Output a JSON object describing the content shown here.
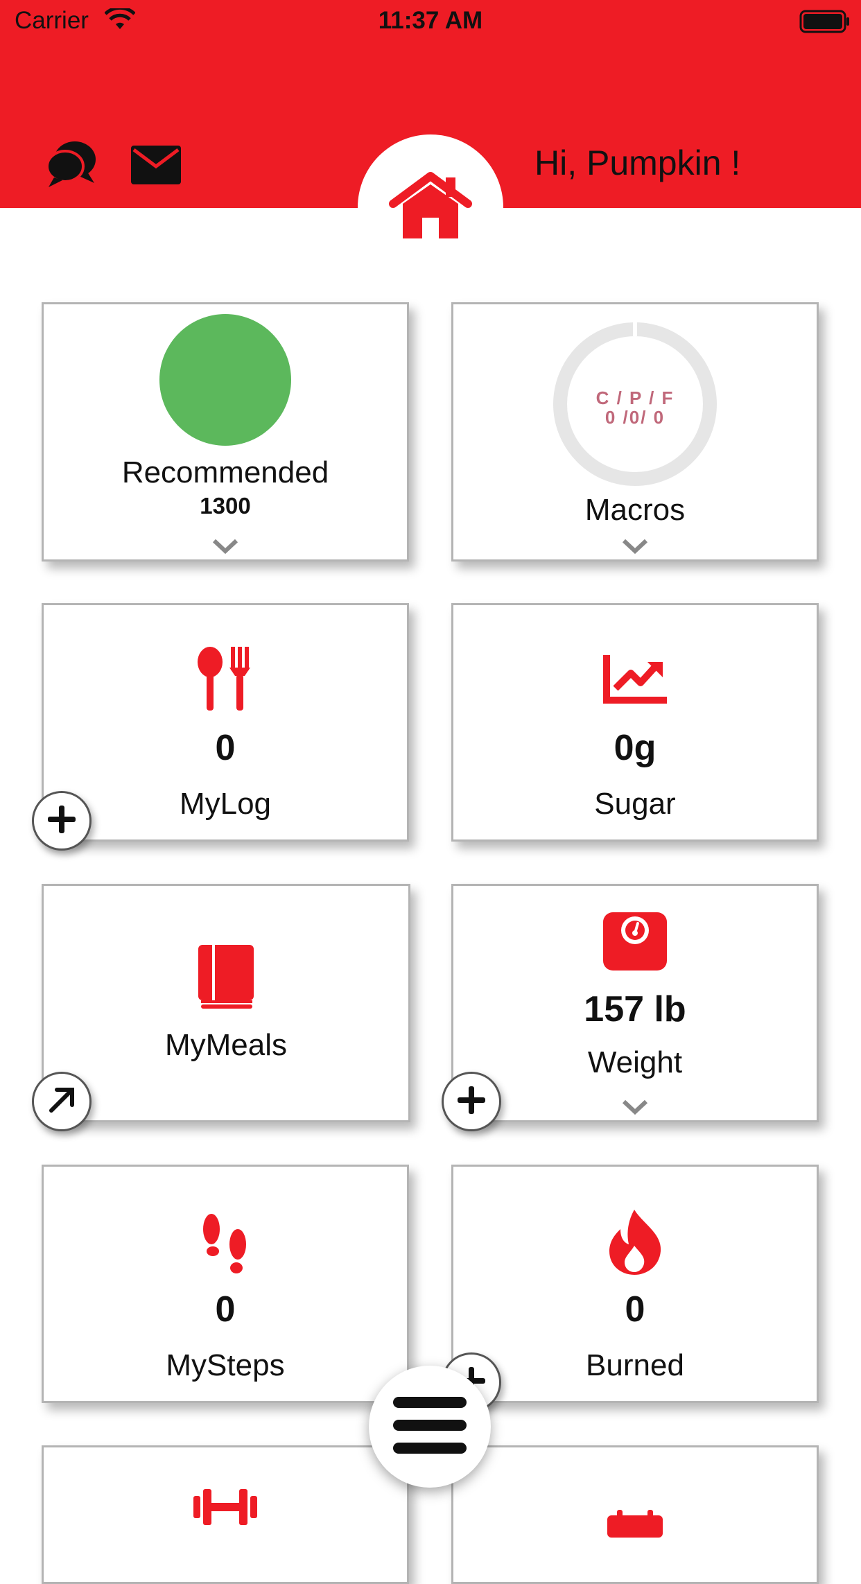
{
  "status_bar": {
    "carrier": "Carrier",
    "time": "11:37 AM"
  },
  "header": {
    "greeting": "Hi, Pumpkin !",
    "accent_color": "#ee1c25"
  },
  "cards": {
    "recommended": {
      "label": "Recommended",
      "value": "1300",
      "ring_color": "#5cb85c"
    },
    "macros": {
      "label": "Macros",
      "heading": "C / P / F",
      "values": "0 /0/ 0",
      "c_color": "#c0687a",
      "p_color": "#5cb85c",
      "f_color": "#1a9bc9"
    },
    "mylog": {
      "label": "MyLog",
      "value": "0"
    },
    "sugar": {
      "label": "Sugar",
      "value": "0g"
    },
    "mymeals": {
      "label": "MyMeals"
    },
    "weight": {
      "label": "Weight",
      "value": "157 lb"
    },
    "mysteps": {
      "label": "MySteps",
      "value": "0"
    },
    "burned": {
      "label": "Burned",
      "value": "0"
    }
  },
  "icons": [
    "chat-icon",
    "mail-icon",
    "home-icon",
    "utensils-icon",
    "chart-up-icon",
    "book-icon",
    "scale-icon",
    "footsteps-icon",
    "fire-icon",
    "dumbbell-icon",
    "calendar-icon",
    "plus-icon",
    "arrow-up-right-icon",
    "menu-icon",
    "chevron-down-icon"
  ]
}
